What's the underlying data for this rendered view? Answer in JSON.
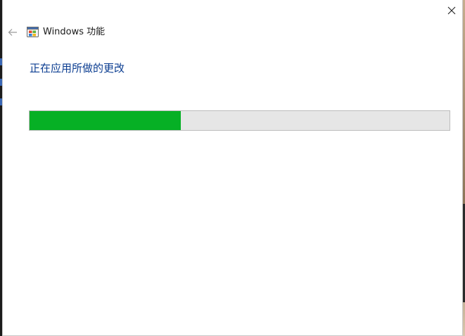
{
  "window": {
    "title": "Windows 功能"
  },
  "main": {
    "heading": "正在应用所做的更改",
    "progress": {
      "fraction": 0.36,
      "fill_color": "#06b025",
      "track_color": "#e6e6e6"
    }
  },
  "icons": {
    "back": "back-arrow-icon",
    "close": "close-icon",
    "app": "windows-features-icon"
  },
  "colors": {
    "heading": "#0b3d91"
  }
}
